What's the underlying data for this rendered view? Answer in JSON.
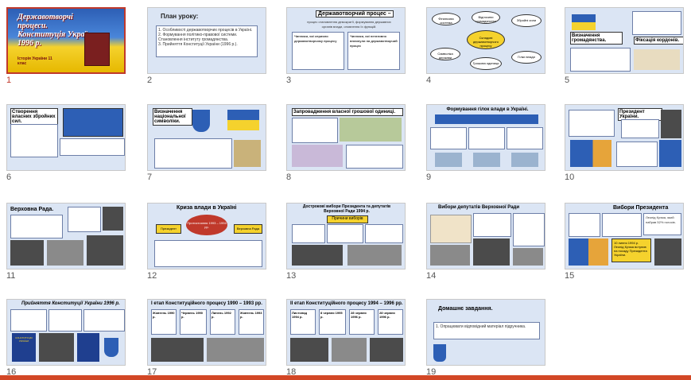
{
  "slides": [
    {
      "num": "1",
      "title": "Державотворчі процеси. Конституція України 1996 р.",
      "subtitle": "Історія України 11 клас"
    },
    {
      "num": "2",
      "title": "План уроку:",
      "items": [
        "1. Особливості державотворчих процесів в Україні.",
        "2. Формування політико-правової системи. Становлення інституту громадянства.",
        "3. Прийняття Конституції України (1996 р.)."
      ]
    },
    {
      "num": "3",
      "title": "Державотворчий процес –",
      "subtitle": "процес становлення демократії, формування державних органів влади, оновлення їх функцій.",
      "col1": "Чинники, які сприяли державотворчому процесу",
      "col2": "Чинники, які негативно вплинули на державотворчий процес"
    },
    {
      "num": "4",
      "center": "Складові державотворчого процесу",
      "nodes": [
        "Фінансова система",
        "Відносини громадянства",
        "Збройні сили",
        "Символіка держави",
        "Грошова одиниця",
        "Гілки влади"
      ]
    },
    {
      "num": "5",
      "left": "Визначення громадянства.",
      "right": "Фіксація кордонів."
    },
    {
      "num": "6",
      "title": "Створення власних збройних сил."
    },
    {
      "num": "7",
      "title": "Визначення національної символіки."
    },
    {
      "num": "8",
      "title": "Запровадження власної грошової одиниці."
    },
    {
      "num": "9",
      "title": "Формування гілок влади в Україні."
    },
    {
      "num": "10",
      "title": "Президент України."
    },
    {
      "num": "11",
      "title": "Верховна Рада."
    },
    {
      "num": "12",
      "title": "Криза влади в Україні",
      "left": "Президент",
      "mid": "Протистояння 1993 – 1994 рр.",
      "right": "Верховна Рада"
    },
    {
      "num": "13",
      "title": "Дострокові вибори Президента та депутатів Верховної Ради 1994 р.",
      "box": "Причини виборів"
    },
    {
      "num": "14",
      "title": "Вибори депутатів Верховної Ради"
    },
    {
      "num": "15",
      "title": "Вибори Президента",
      "note1": "Леонід Кучма, який набрав 52% голосів.",
      "note2": "10 липня 1994 р. Леонід Кучма вступив на посаду Президента України."
    },
    {
      "num": "16",
      "title": "Прийняття Конституції України 1996 р.",
      "book": "КОНСТИТУЦІЯ УКРАЇНИ"
    },
    {
      "num": "17",
      "title": "І етап Конституційного процесу 1990 – 1993 рр.",
      "dates": [
        "Жовтень 1990 р.",
        "Червень 1990 р.",
        "Липень 1992 р.",
        "Жовтень 1993 р."
      ]
    },
    {
      "num": "18",
      "title": "ІІ етап Конституційного процесу 1994 – 1996 рр.",
      "dates": [
        "Листопад 1994 р.",
        "8 червня 1995 р.",
        "28 червня 1996 р.",
        "28 червня 1996 р."
      ]
    },
    {
      "num": "19",
      "title": "Домашнє завдання.",
      "items": [
        "1. Опрацювати відповідний матеріал підручника."
      ]
    }
  ],
  "colors": {
    "selected_border": "#c0392b",
    "status_bar": "#d24726"
  }
}
